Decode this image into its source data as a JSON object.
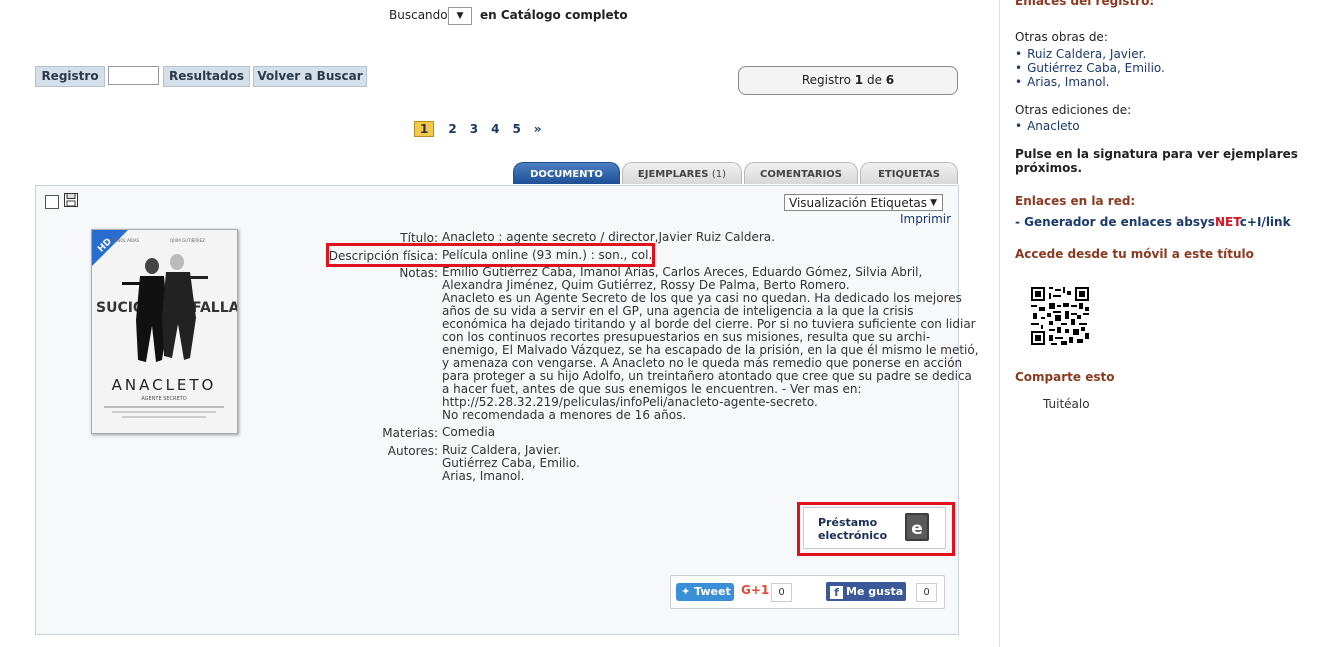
{
  "top": {
    "buscando": "Buscando",
    "select_arrow": "▼",
    "scope": "en Catálogo completo"
  },
  "nav": {
    "registro": "Registro",
    "resultados": "Resultados",
    "volver": "Volver a Buscar",
    "registro_label": "Registro",
    "registro_current": "1",
    "registro_of": "de",
    "registro_total": "6"
  },
  "pagination": {
    "current": "1",
    "pages": [
      "2",
      "3",
      "4",
      "5"
    ],
    "next": "»"
  },
  "tabs": {
    "documento": "DOCUMENTO",
    "ejemplares": "EJEMPLARES",
    "ejemplares_count": "(1)",
    "comentarios": "COMENTARIOS",
    "etiquetas": "ETIQUETAS"
  },
  "toolbar": {
    "view_select": "Visualización Etiquetas",
    "imprimir": "Imprimir"
  },
  "record": {
    "titulo_label": "Título:",
    "titulo": "Anacleto : agente secreto / director,Javier Ruiz Caldera.",
    "desc_label": "Descripción física:",
    "desc": "Película online (93 min.) : son., col.",
    "notas_label": "Notas:",
    "notas_lines": [
      "Emilio Gutiérrez Caba, Imanol Arias, Carlos Areces, Eduardo Gómez, Silvia Abril,",
      "Alexandra Jiménez, Quim Gutiérrez, Rossy De Palma, Berto Romero.",
      "Anacleto es un Agente Secreto de los que ya casi no quedan. Ha dedicado los mejores",
      "años de su vida a servir en el GP, una agencia de inteligencia a la que la crisis",
      "económica ha dejado tiritando y al borde del cierre. Por si no tuviera suficiente con lidiar",
      "con los continuos recortes presupuestarios en sus misiones, resulta que su archi-",
      "enemigo, El Malvado Vázquez, se ha escapado de la prisión, en la que él mismo le metió,",
      "y amenaza con vengarse. A Anacleto no le queda más remedio que ponerse en acción",
      "para proteger a su hijo Adolfo, un treintañero atontado que cree que su padre se dedica",
      "a hacer fuet, antes de que sus enemigos le encuentren. - Ver mas en:",
      "http://52.28.32.219/peliculas/infoPeli/anacleto-agente-secreto.",
      "No recomendada a menores de 16 años."
    ],
    "materias_label": "Materias:",
    "materias": "Comedia",
    "autores_label": "Autores:",
    "autores": [
      "Ruiz Caldera, Javier.",
      "Gutiérrez Caba, Emilio.",
      "Arias, Imanol."
    ]
  },
  "poster": {
    "badge": "HD",
    "actors_left": "IMANOL ARIAS",
    "actors_right": "QUIM GUTIÉRREZ",
    "title": "ANACLETO",
    "subtitle": "AGENTE SECRETO",
    "art_left": "SUCIO",
    "art_right": "FALLA"
  },
  "prestamo": {
    "line1": "Préstamo",
    "line2": "electrónico"
  },
  "social": {
    "tweet": "Tweet",
    "gplus": "G+1",
    "gplus_count": "0",
    "fb": "Me gusta",
    "fb_count": "0"
  },
  "right": {
    "enlaces_registro": "Enlaces del registro:",
    "otras_obras": "Otras obras de:",
    "obras": [
      "Ruiz Caldera, Javier.",
      "Gutiérrez Caba, Emilio.",
      "Arias, Imanol."
    ],
    "otras_ediciones": "Otras ediciones de:",
    "ediciones": [
      "Anacleto"
    ],
    "pulse": "Pulse en la signatura para ver ejemplares próximos.",
    "enlaces_red": "Enlaces en la red:",
    "gen_prefix": "- Generador de enlaces absys",
    "gen_net": "NET",
    "gen_suffix": "c+I/link",
    "movil": "Accede desde tu móvil a este título",
    "comparte": "Comparte esto",
    "tuitealo": "Tuitéalo"
  }
}
